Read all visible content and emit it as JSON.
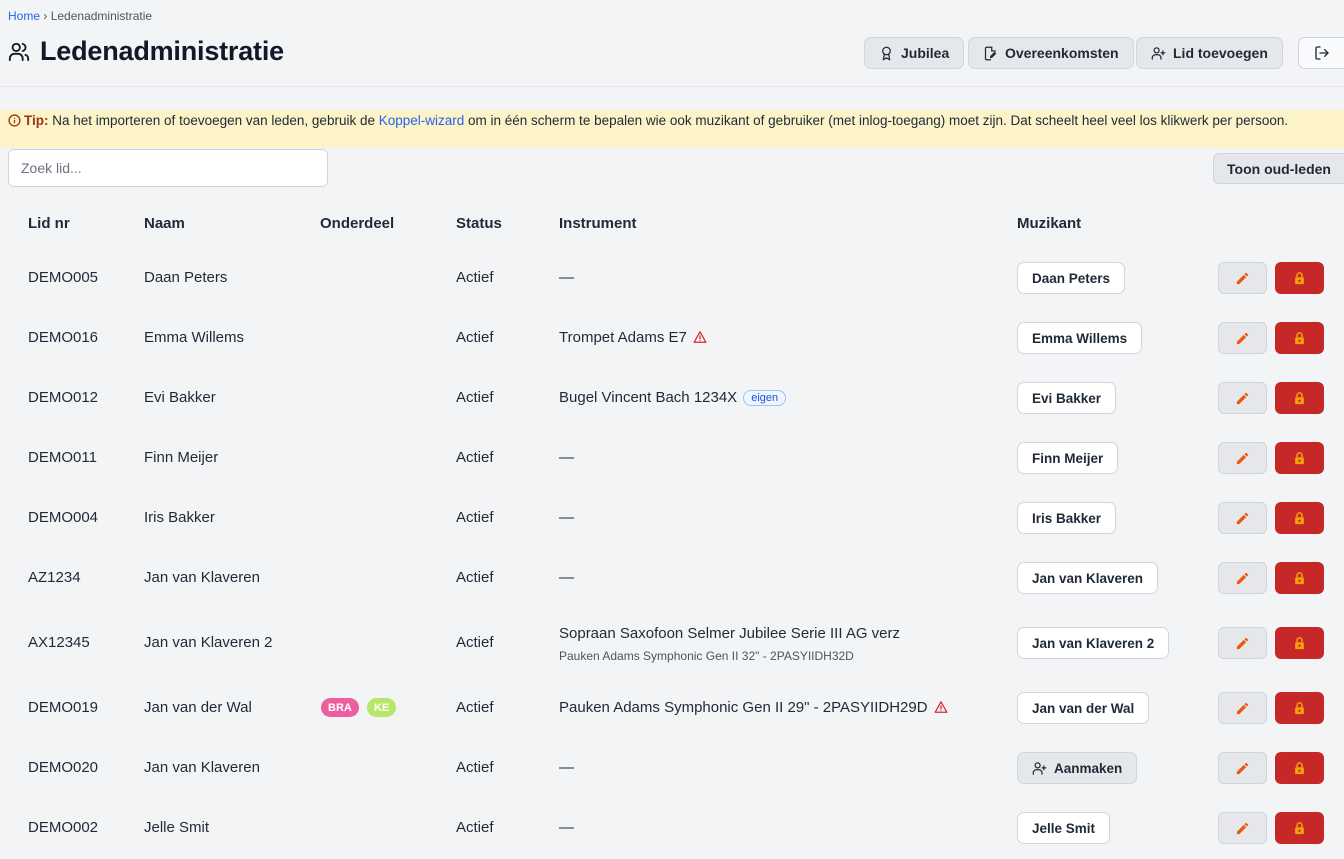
{
  "breadcrumb": {
    "home": "Home",
    "separator": "›",
    "current": "Ledenadministratie"
  },
  "page_title": "Ledenadministratie",
  "header_buttons": {
    "jubilea": "Jubilea",
    "overeenkomsten": "Overeenkomsten",
    "lid_toevoegen": "Lid toevoegen"
  },
  "tip": {
    "label": "Tip:",
    "before": " Na het importeren of toevoegen van leden, gebruik de ",
    "link": "Koppel-wizard",
    "after": " om in één scherm te bepalen wie ook muzikant of gebruiker (met inlog-toegang) moet zijn. Dat scheelt heel veel los klikwerk per persoon."
  },
  "search": {
    "placeholder": "Zoek lid..."
  },
  "toon_oud_leden": "Toon oud-leden",
  "columns": {
    "lidnr": "Lid nr",
    "naam": "Naam",
    "onderdeel": "Onderdeel",
    "status": "Status",
    "instrument": "Instrument",
    "muzikant": "Muzikant"
  },
  "colors": {
    "accent": "#2563eb",
    "danger": "#c62828",
    "tip_bg": "#fdf3c8",
    "edit_icon": "#ea580c"
  },
  "rows": [
    {
      "lidnr": "DEMO005",
      "naam": "Daan Peters",
      "status": "Actief",
      "instrument": "—",
      "muzikant": "Daan Peters"
    },
    {
      "lidnr": "DEMO016",
      "naam": "Emma Willems",
      "status": "Actief",
      "instrument": "Trompet Adams E7",
      "muzikant": "Emma Willems"
    },
    {
      "lidnr": "DEMO012",
      "naam": "Evi Bakker",
      "status": "Actief",
      "instrument": "Bugel Vincent Bach 1234X",
      "eigen": "eigen",
      "muzikant": "Evi Bakker"
    },
    {
      "lidnr": "DEMO011",
      "naam": "Finn Meijer",
      "status": "Actief",
      "instrument": "—",
      "muzikant": "Finn Meijer"
    },
    {
      "lidnr": "DEMO004",
      "naam": "Iris Bakker",
      "status": "Actief",
      "instrument": "—",
      "muzikant": "Iris Bakker"
    },
    {
      "lidnr": "AZ1234",
      "naam": "Jan van Klaveren",
      "status": "Actief",
      "instrument": "—",
      "muzikant": "Jan van Klaveren"
    },
    {
      "lidnr": "AX12345",
      "naam": "Jan van Klaveren 2",
      "status": "Actief",
      "instrument": "Sopraan Saxofoon Selmer Jubilee Serie III AG verz",
      "instrument_sub": "Pauken Adams Symphonic Gen II 32\" - 2PASYIIDH32D",
      "muzikant": "Jan van Klaveren 2"
    },
    {
      "lidnr": "DEMO019",
      "naam": "Jan van der Wal",
      "onderdeel": [
        "BRA",
        "KE"
      ],
      "status": "Actief",
      "instrument": "Pauken Adams Symphonic Gen II 29\" - 2PASYIIDH29D",
      "muzikant": "Jan van der Wal"
    },
    {
      "lidnr": "DEMO020",
      "naam": "Jan van Klaveren",
      "status": "Actief",
      "instrument": "—",
      "muzikant_create": "Aanmaken"
    },
    {
      "lidnr": "DEMO002",
      "naam": "Jelle Smit",
      "status": "Actief",
      "instrument": "—",
      "muzikant": "Jelle Smit"
    }
  ]
}
